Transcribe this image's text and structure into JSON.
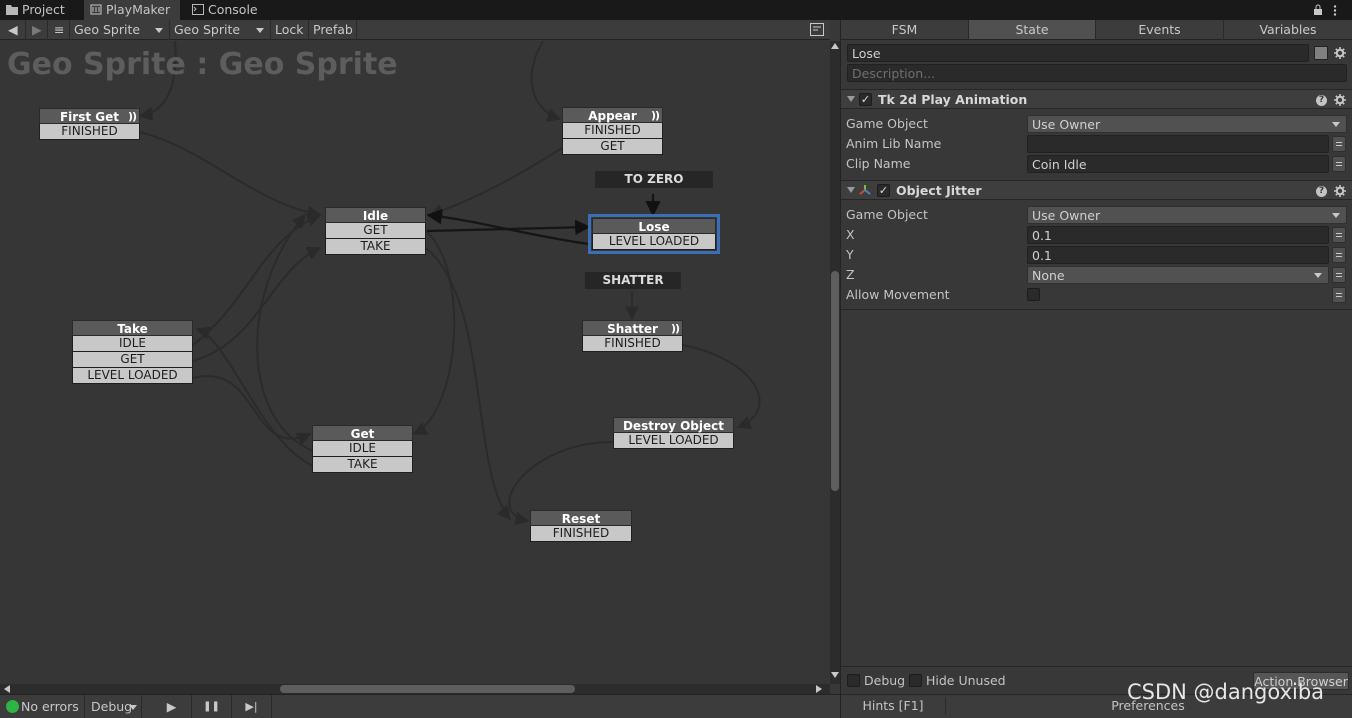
{
  "tabs": {
    "project": "Project",
    "playmaker": "PlayMaker",
    "console": "Console"
  },
  "toolbar": {
    "back": "◀",
    "forward": "▶",
    "menu": "≡",
    "object_select": "Geo Sprite",
    "fsm_select": "Geo Sprite",
    "lock": "Lock",
    "prefab": "Prefab"
  },
  "graph": {
    "title": "Geo Sprite : Geo Sprite",
    "states": {
      "first_get": {
        "name": "First Get",
        "transitions": [
          "FINISHED"
        ]
      },
      "appear": {
        "name": "Appear",
        "transitions": [
          "FINISHED",
          "GET"
        ]
      },
      "idle": {
        "name": "Idle",
        "transitions": [
          "GET",
          "TAKE"
        ]
      },
      "lose": {
        "name": "Lose",
        "transitions": [
          "LEVEL LOADED"
        ]
      },
      "take": {
        "name": "Take",
        "transitions": [
          "IDLE",
          "GET",
          "LEVEL LOADED"
        ]
      },
      "shatter": {
        "name": "Shatter",
        "transitions": [
          "FINISHED"
        ]
      },
      "get": {
        "name": "Get",
        "transitions": [
          "IDLE",
          "TAKE"
        ]
      },
      "destroy_object": {
        "name": "Destroy Object",
        "transitions": [
          "LEVEL LOADED"
        ]
      },
      "reset": {
        "name": "Reset",
        "transitions": [
          "FINISHED"
        ]
      }
    },
    "global_events": {
      "to_zero": "TO ZERO",
      "shatter": "SHATTER"
    },
    "sequence_glyph": "))"
  },
  "statusbar": {
    "errors": "No errors",
    "debug": "Debug",
    "play": "▶",
    "pause": "❚❚",
    "step": "▶|"
  },
  "inspector": {
    "tabs": [
      "FSM",
      "State",
      "Events",
      "Variables"
    ],
    "active_tab": "State",
    "state_name": "Lose",
    "description_placeholder": "Description...",
    "actions": [
      {
        "title": "Tk 2d Play Animation",
        "enabled": true,
        "fields": [
          {
            "label": "Game Object",
            "value": "Use Owner",
            "kind": "dropdown"
          },
          {
            "label": "Anim Lib Name",
            "value": "",
            "kind": "text"
          },
          {
            "label": "Clip Name",
            "value": "Coin Idle",
            "kind": "text"
          }
        ]
      },
      {
        "title": "Object Jitter",
        "enabled": true,
        "fields": [
          {
            "label": "Game Object",
            "value": "Use Owner",
            "kind": "dropdown"
          },
          {
            "label": "X",
            "value": "0.1",
            "kind": "text"
          },
          {
            "label": "Y",
            "value": "0.1",
            "kind": "text"
          },
          {
            "label": "Z",
            "value": "None",
            "kind": "dropdown"
          },
          {
            "label": "Allow Movement",
            "value": "",
            "kind": "checkbox"
          }
        ]
      }
    ],
    "bottom": {
      "debug": "Debug",
      "hide_unused": "Hide Unused",
      "action_browser": "Action Browser",
      "hints": "Hints [F1]",
      "preferences": "Preferences"
    }
  },
  "watermark": "CSDN @dangoxiba",
  "colors": {
    "selected_outline": "#3a6fb8",
    "status_ok": "#2fb344",
    "node_header": "#5a5a5a",
    "node_transition": "#c8c8c8"
  }
}
